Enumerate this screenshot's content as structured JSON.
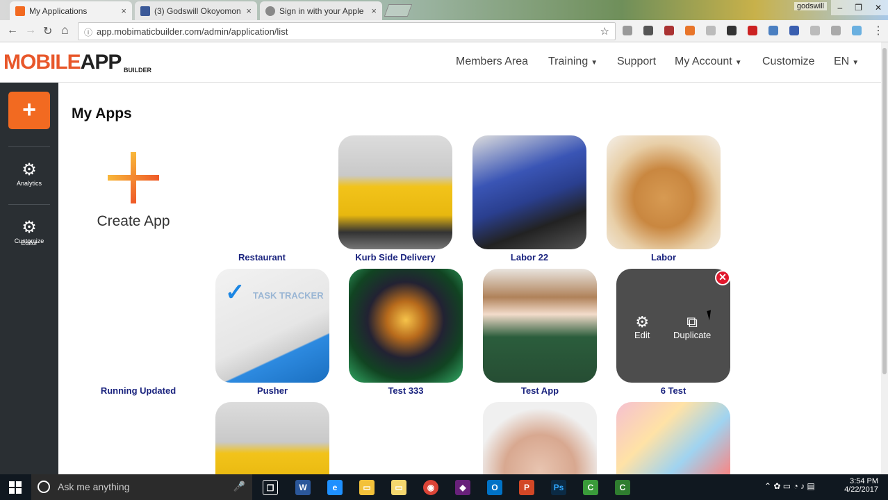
{
  "browser": {
    "tabs": [
      {
        "title": "My Applications",
        "close": "×",
        "icon_color": "#f26a21"
      },
      {
        "title": "(3) Godswill Okoyomon",
        "close": "×",
        "icon_color": "#3b5998"
      },
      {
        "title": "Sign in with your Apple",
        "close": "×",
        "icon_color": "#888888"
      }
    ],
    "user": "godswill",
    "window_controls": {
      "minimize": "–",
      "restore": "❐",
      "close": "✕"
    },
    "url": "app.mobimaticbuilder.com/admin/application/list",
    "nav": {
      "back": "←",
      "forward": "→",
      "reload": "↻",
      "home": "⌂",
      "star": "☆",
      "info": "ⓘ"
    }
  },
  "header": {
    "logo_main": "MOBILE",
    "logo_app": "APP",
    "logo_sub": "BUILDER",
    "menu": [
      {
        "label": "Members Area",
        "caret": ""
      },
      {
        "label": "Training",
        "caret": "▼"
      },
      {
        "label": "Support",
        "caret": ""
      },
      {
        "label": "My Account",
        "caret": "▼"
      },
      {
        "label": "Customize",
        "caret": ""
      },
      {
        "label": "EN",
        "caret": "▼"
      }
    ]
  },
  "sidebar": {
    "add_glyph": "+",
    "items": [
      {
        "label": "Analytics",
        "icon": "gear-icon",
        "glyph": "⚙"
      },
      {
        "label": "Customize",
        "sub": "Editor",
        "icon": "gear-icon",
        "glyph": "⚙"
      }
    ]
  },
  "main": {
    "title": "My Apps",
    "create_label": "Create App",
    "apps": [
      {
        "name": "Restaurant",
        "thumb": "none"
      },
      {
        "name": "Kurb Side Delivery",
        "thumb": "taxi"
      },
      {
        "name": "Labor 22",
        "thumb": "mechanic"
      },
      {
        "name": "Labor",
        "thumb": "bread"
      },
      {
        "name": "Running Updated",
        "thumb": "none"
      },
      {
        "name": "Pusher",
        "thumb": "task-tracker",
        "thumb_text": "TASK TRACKER"
      },
      {
        "name": "Test 333",
        "thumb": "eiffel"
      },
      {
        "name": "Test App",
        "thumb": "woman-coffee"
      },
      {
        "name": "6 Test",
        "thumb": "hover-actions"
      },
      {
        "name": "",
        "thumb": "taxi"
      },
      {
        "name": "",
        "thumb": "face"
      },
      {
        "name": "",
        "thumb": "art"
      }
    ],
    "hover_actions": {
      "edit": "Edit",
      "duplicate": "Duplicate",
      "edit_glyph": "⚙",
      "duplicate_glyph": "⧉",
      "delete_glyph": "✕"
    }
  },
  "taskbar": {
    "search_placeholder": "Ask me anything",
    "mic": "🎤",
    "time": "3:54 PM",
    "date": "4/22/2017",
    "apps": [
      {
        "name": "task-view",
        "label": "❐",
        "color": "#101820"
      },
      {
        "name": "word",
        "label": "W",
        "color": "#2b579a"
      },
      {
        "name": "edge",
        "label": "e",
        "color": "#1e90ff"
      },
      {
        "name": "explorer",
        "label": "▭",
        "color": "#f3c13a"
      },
      {
        "name": "folder",
        "label": "▭",
        "color": "#f5d76e"
      },
      {
        "name": "chrome",
        "label": "◉",
        "color": "#db4437"
      },
      {
        "name": "visual-studio",
        "label": "◆",
        "color": "#68217a"
      },
      {
        "name": "outlook",
        "label": "O",
        "color": "#0072c6"
      },
      {
        "name": "powerpoint",
        "label": "P",
        "color": "#d24726"
      },
      {
        "name": "photoshop",
        "label": "Ps",
        "color": "#0b2a44"
      },
      {
        "name": "camtasia",
        "label": "C",
        "color": "#3a9b3a"
      },
      {
        "name": "camtasia-recorder",
        "label": "C",
        "color": "#2f7d2f"
      }
    ]
  }
}
